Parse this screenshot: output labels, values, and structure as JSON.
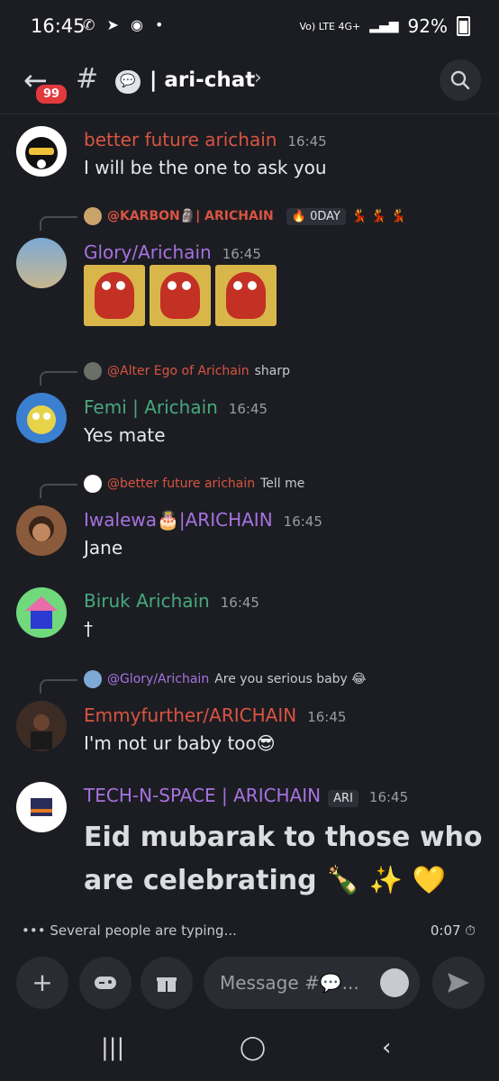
{
  "status": {
    "time": "16:45",
    "app_icons": "✆ ➤ ◉ •",
    "network": "Vo) LTE 4G+",
    "battery": "92%"
  },
  "header": {
    "back_badge": "99",
    "channel_emoji": "💬",
    "channel_name": "| ari-chat",
    "chevron": "›"
  },
  "messages": [
    {
      "user": "better future arichain",
      "time": "16:45",
      "text": "I will be the one to ask you",
      "color": "#d95442"
    },
    {
      "reply_user": "@KARBON🗿| ARICHAIN",
      "reply_tag": "🔥 0DAY",
      "reply_extra": "💃 💃 💃",
      "user": "Glory/Arichain",
      "time": "16:45",
      "color": "#a672e0"
    },
    {
      "reply_user": "@Alter Ego of  Arichain",
      "reply_text": "sharp",
      "user": "Femi | Arichain",
      "time": "16:45",
      "text": "Yes mate",
      "color": "#46a97e"
    },
    {
      "reply_user": "@better future arichain",
      "reply_text": "Tell me",
      "user": "Iwalewa🎂|ARICHAIN",
      "time": "16:45",
      "text": "Jane",
      "color": "#a672e0"
    },
    {
      "user": "Biruk Arichain",
      "time": "16:45",
      "text": "†",
      "color": "#46a97e"
    },
    {
      "reply_user": "@Glory/Arichain",
      "reply_text": "Are you serious baby 😂",
      "user": "Emmyfurther/ARICHAIN",
      "time": "16:45",
      "text": "I'm not ur baby too😎",
      "color": "#d95442"
    },
    {
      "user": "TECH-N-SPACE | ARICHAIN",
      "tag": "ARI",
      "time": "16:45",
      "text_line1": "Eid mubarak to those who",
      "text_line2": "are celebrating 🍾 ✨ 💛",
      "color": "#a672e0"
    }
  ],
  "typing": {
    "text": "Several people are typing...",
    "time": "0:07 ⏱"
  },
  "composer": {
    "placeholder": "Message #💬..."
  },
  "nav": {
    "recent": "|||",
    "home": "◯",
    "back": "‹"
  }
}
